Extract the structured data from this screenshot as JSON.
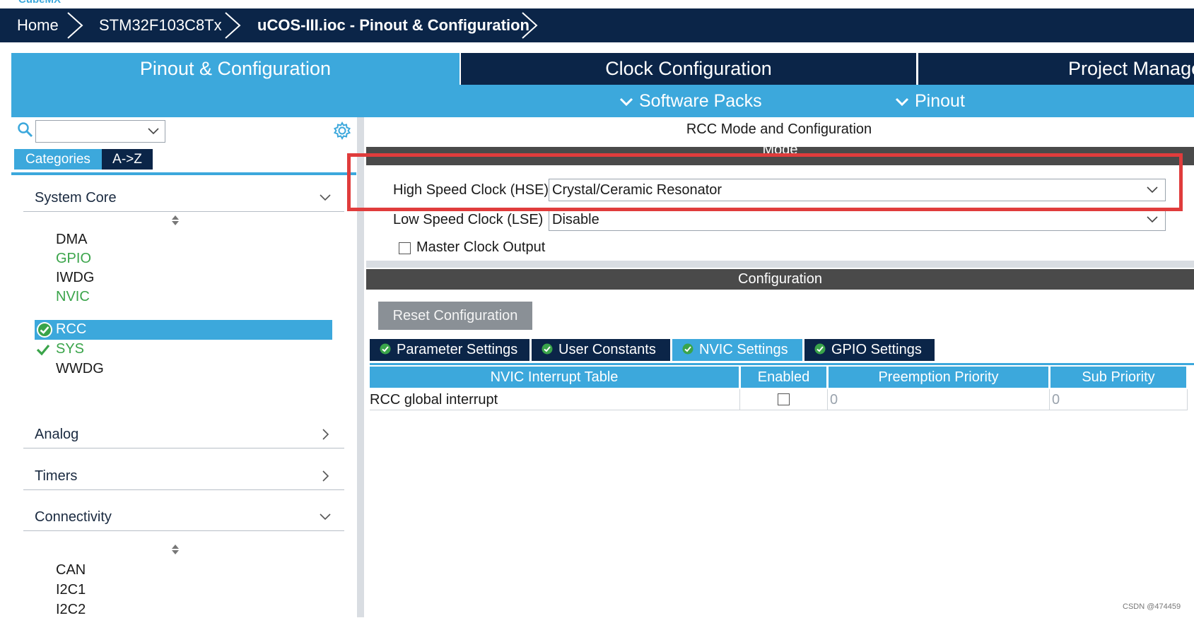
{
  "app": {
    "logo_text": "CubeMX"
  },
  "breadcrumb": {
    "items": [
      "Home",
      "STM32F103C8Tx",
      "uCOS-III.ioc - Pinout & Configuration"
    ]
  },
  "main_tabs": [
    {
      "label": "Pinout & Configuration",
      "active": true
    },
    {
      "label": "Clock Configuration",
      "active": false
    },
    {
      "label": "Project Manager",
      "active": false
    }
  ],
  "sub_toolbar": {
    "software_packs": "Software Packs",
    "pinout": "Pinout"
  },
  "left_panel": {
    "search_value": "",
    "tabs": [
      "Categories",
      "A->Z"
    ],
    "categories": [
      {
        "label": "System Core",
        "expanded": true
      },
      {
        "label": "Analog",
        "expanded": false
      },
      {
        "label": "Timers",
        "expanded": false
      },
      {
        "label": "Connectivity",
        "expanded": true
      }
    ],
    "system_core_items": [
      {
        "label": "DMA",
        "state": "normal"
      },
      {
        "label": "GPIO",
        "state": "green"
      },
      {
        "label": "IWDG",
        "state": "normal"
      },
      {
        "label": "NVIC",
        "state": "green"
      },
      {
        "label": "RCC",
        "state": "selected"
      },
      {
        "label": "SYS",
        "state": "checked"
      },
      {
        "label": "WWDG",
        "state": "normal"
      }
    ],
    "connectivity_items": [
      "CAN",
      "I2C1",
      "I2C2"
    ]
  },
  "rcc": {
    "title": "RCC Mode and Configuration",
    "mode_header": "Mode",
    "hse_label": "High Speed Clock (HSE)",
    "hse_value": "Crystal/Ceramic Resonator",
    "lse_label": "Low Speed Clock (LSE)",
    "lse_value": "Disable",
    "mco_label": "Master Clock Output",
    "mco_checked": false,
    "config_header": "Configuration",
    "reset_button": "Reset Configuration",
    "tabs": [
      {
        "label": "Parameter Settings",
        "active": false
      },
      {
        "label": "User Constants",
        "active": false
      },
      {
        "label": "NVIC Settings",
        "active": true
      },
      {
        "label": "GPIO Settings",
        "active": false
      }
    ],
    "nvic_table": {
      "columns": [
        "NVIC Interrupt Table",
        "Enabled",
        "Preemption Priority",
        "Sub Priority"
      ],
      "rows": [
        {
          "name": "RCC global interrupt",
          "enabled": false,
          "preemption": "0",
          "sub": "0"
        }
      ]
    }
  },
  "colors": {
    "dark_navy": "#0b2548",
    "accent_blue": "#3ca8dc",
    "green": "#3aa44a",
    "highlight_red": "#e03c3c"
  },
  "watermark": "CSDN @474459"
}
